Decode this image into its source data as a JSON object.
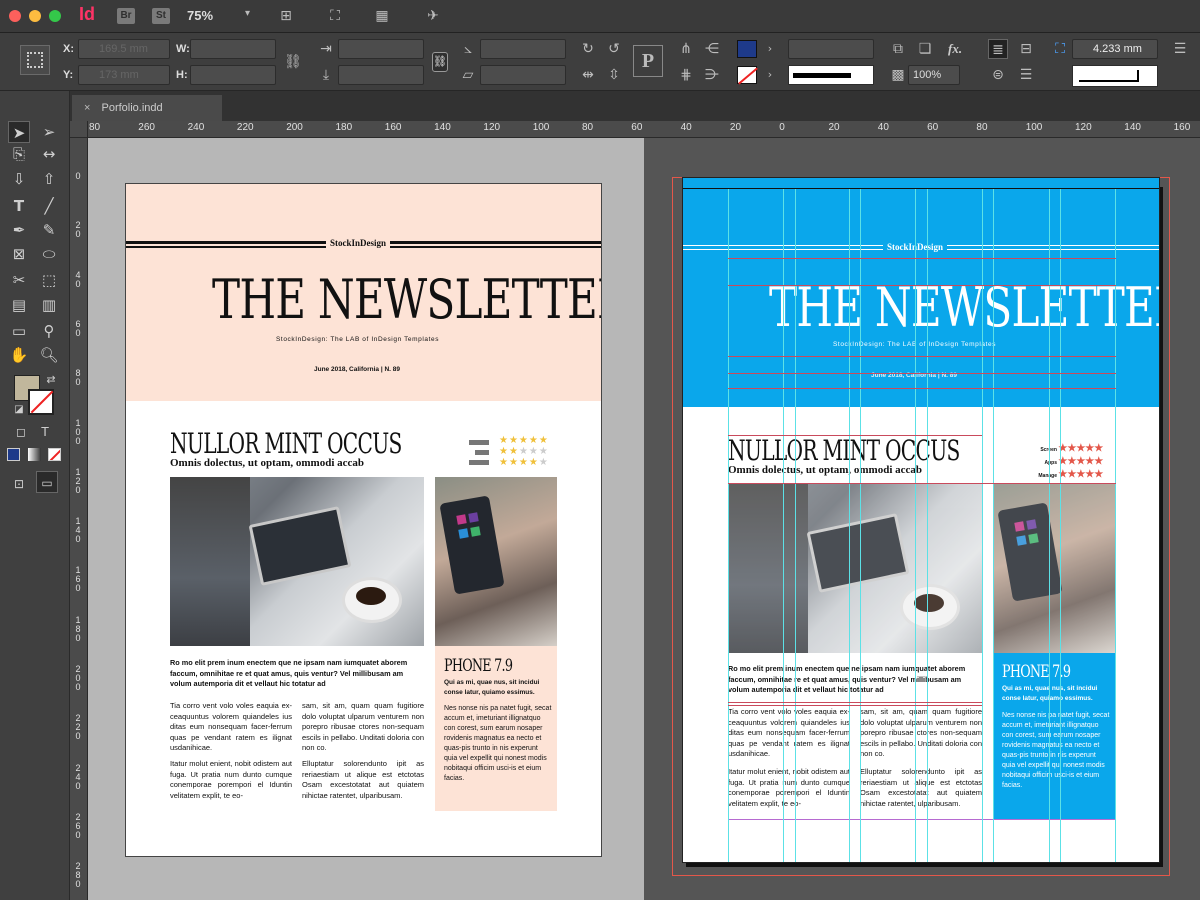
{
  "titlebar": {
    "app_icon": "Id",
    "bridge_label": "Br",
    "stock_label": "St",
    "zoom": "75%"
  },
  "control": {
    "x_label": "X:",
    "y_label": "Y:",
    "w_label": "W:",
    "h_label": "H:",
    "x_value": "169.5 mm",
    "y_value": "173 mm",
    "scale_value": "100%",
    "stroke_value": "4.233 mm",
    "fx_label": "fx."
  },
  "tab": {
    "name": "Porfolio.indd"
  },
  "rulers": {
    "h_labels": [
      "80",
      "260",
      "240",
      "220",
      "200",
      "180",
      "160",
      "140",
      "120",
      "100",
      "80",
      "60",
      "40",
      "20",
      "0",
      "20",
      "40",
      "60",
      "80",
      "100",
      "120",
      "140",
      "160"
    ],
    "v_labels": [
      "0",
      "2\n0",
      "4\n0",
      "6\n0",
      "8\n0",
      "1\n0\n0",
      "1\n2\n0",
      "1\n4\n0",
      "1\n6\n0",
      "1\n8\n0",
      "2\n0\n0",
      "2\n2\n0",
      "2\n4\n0",
      "2\n6\n0",
      "2\n8\n0"
    ]
  },
  "newsletter": {
    "brand": "StockInDesign",
    "title": "THE NEWSLETTER",
    "tagline": "StockInDesign: The LAB of InDesign Templates",
    "date": "June 2018, California | N. 89",
    "headline": "NULLOR MINT OCCUS",
    "subhead": "Omnis dolectus, ut optam, ommodi accab",
    "lead": "Ro mo elit prem inum enectem que ne ipsam nam iumquatet aborem faccum, omnihitae re et quat amus, quis ventur? Vel millibusam am volum autemporia dit et vellaut hic totatur ad",
    "col1_p1": "Tia corro vent volo voles eaquia ex-ceaquuntus volorem quiandeles ius ditas eum nonsequam facer-ferrum quas pe vendant ratem es ilignat usdanihicae.",
    "col1_p2": "Itatur molut enient, nobit odistem aut fuga. Ut pratia num dunto cumque conemporae porempori el Iduntin velitatem explit, te eo-",
    "col2_p1": "sam, sit am, quam quam fugitiore dolo voluptat ulparum venturem non porepro ribusae ctores non-sequam escils in pellabo. Unditati doloria con non co.",
    "col2_p2": "Elluptatur solorendunto ipit as reriaestiam ut alique est etctotas Osam excestotatat aut quiatem nihictae ratentet, ulparibusam.",
    "side_title": "PHONE 7.9",
    "side_p1": "Qui as mi, quae nus, sit incidui conse latur, quiamo essimus.",
    "side_p2": "Nes nonse nis pa natet fugit, secat accum et, imeturiant illignatquo con corest, sum earum nosaper rovidenis magnatus ea necto et quas-pis trunto in nis experunt quia vel expellit qui nonest modis nobitaqui officim usci-is et eium facias.",
    "ratings": [
      {
        "label": "Screen",
        "stars": 5
      },
      {
        "label": "Apps",
        "stars": 2
      },
      {
        "label": "Manage",
        "stars": 4
      }
    ]
  },
  "colors": {
    "peach": "#fde3d6",
    "blue": "#0aa7eb",
    "star": "#f0c03a"
  }
}
